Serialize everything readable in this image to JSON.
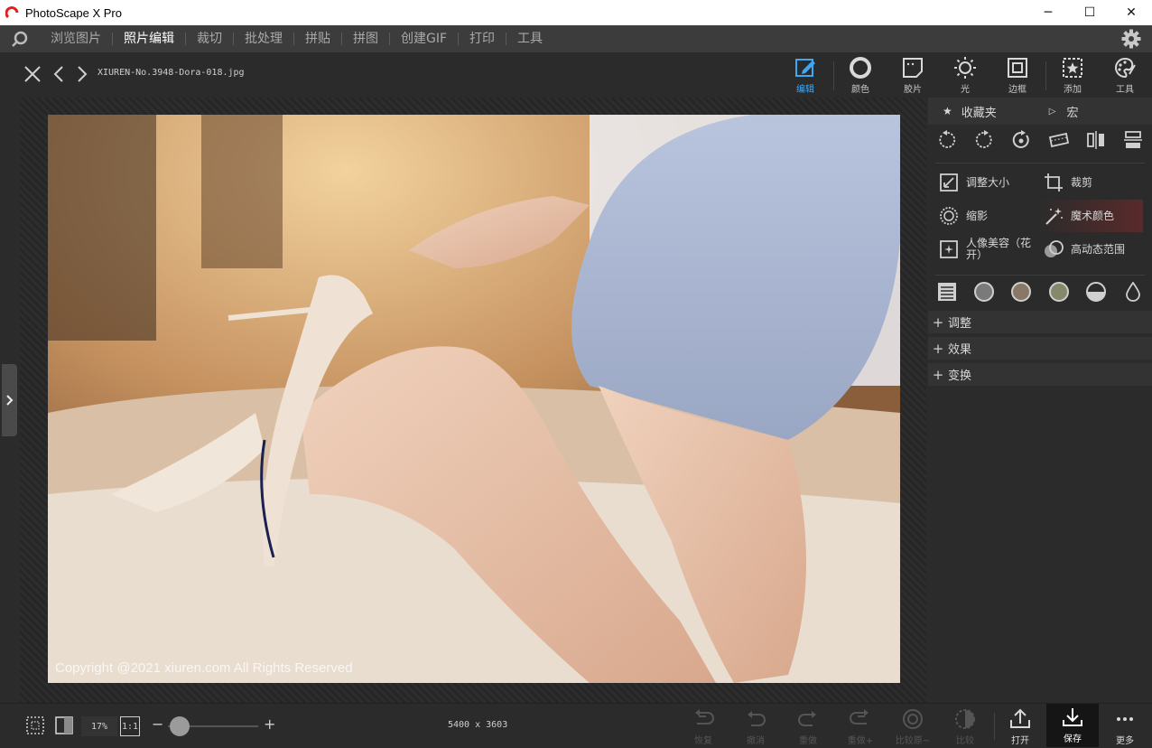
{
  "window": {
    "title": "PhotoScape X Pro",
    "minimize": "─",
    "maximize": "☐",
    "close": "✕"
  },
  "nav": {
    "items": [
      "浏览图片",
      "照片编辑",
      "裁切",
      "批处理",
      "拼贴",
      "拼图",
      "创建GIF",
      "打印",
      "工具"
    ],
    "active_index": 1
  },
  "toolbar": {
    "filename": "XIUREN-No.3948-Dora-018.jpg",
    "modes": [
      {
        "label": "编辑",
        "icon": "edit-icon",
        "active": true
      },
      {
        "label": "颜色",
        "icon": "color-icon",
        "active": false
      },
      {
        "label": "胶片",
        "icon": "film-icon",
        "active": false
      },
      {
        "label": "光",
        "icon": "light-icon",
        "active": false
      },
      {
        "label": "边框",
        "icon": "frame-icon",
        "active": false
      },
      {
        "label": "添加",
        "icon": "add-icon",
        "active": false
      },
      {
        "label": "工具",
        "icon": "tools-icon",
        "active": false
      }
    ]
  },
  "photo": {
    "watermark": "Copyright @2021  xiuren.com  All Rights Reserved"
  },
  "panel": {
    "favorites": "收藏夹",
    "macro": "宏",
    "tools": [
      {
        "label": "调整大小",
        "icon": "resize-icon"
      },
      {
        "label": "裁剪",
        "icon": "crop-icon"
      },
      {
        "label": "缩影",
        "icon": "vignette-icon"
      },
      {
        "label": "魔术颜色",
        "icon": "magic-color-icon"
      },
      {
        "label": "人像美容（花开）",
        "icon": "beauty-icon"
      },
      {
        "label": "高动态范围",
        "icon": "hdr-icon"
      }
    ],
    "sections": [
      "调整",
      "效果",
      "变换"
    ],
    "accent": "#3da9f5",
    "highlight": "#5a2a2a"
  },
  "status": {
    "zoom": "17%",
    "one_to_one": "1:1",
    "dimensions": "5400 x 3603",
    "actions": [
      {
        "label": "恢复",
        "icon": "revert-icon",
        "enabled": false
      },
      {
        "label": "撤消",
        "icon": "undo-icon",
        "enabled": false
      },
      {
        "label": "重做",
        "icon": "redo-icon",
        "enabled": false
      },
      {
        "label": "重做+",
        "icon": "redo-all-icon",
        "enabled": false
      },
      {
        "label": "比较原~",
        "icon": "compare-original-icon",
        "enabled": false
      },
      {
        "label": "比较",
        "icon": "compare-icon",
        "enabled": false
      },
      {
        "label": "打开",
        "icon": "open-icon",
        "enabled": true
      },
      {
        "label": "保存",
        "icon": "save-icon",
        "enabled": true
      },
      {
        "label": "更多",
        "icon": "more-icon",
        "enabled": true
      }
    ]
  }
}
